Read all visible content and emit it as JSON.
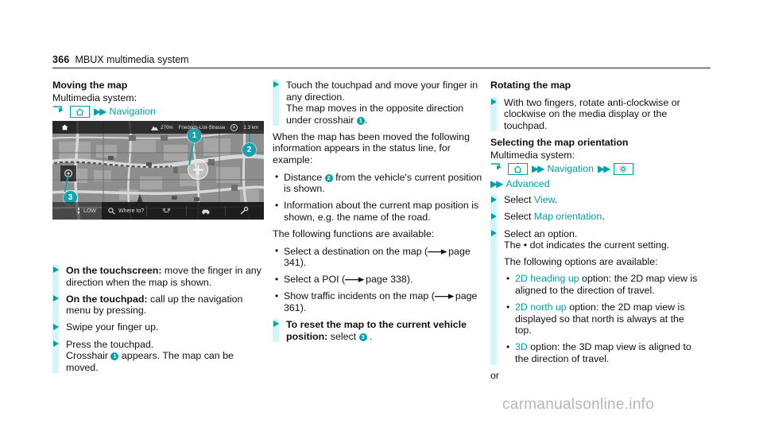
{
  "header": {
    "page_number": "366",
    "title": "MBUX multimedia system"
  },
  "watermark": "carmanualsonline.info",
  "colors": {
    "teal": "#00a0a8",
    "band": "#d2f5f7",
    "badge": "#17a2ad"
  },
  "col1": {
    "heading": "Moving the map",
    "intro": "Multimedia system:",
    "nav_path": {
      "return_icon": "return-arrow-icon",
      "home_icon": "home-icon",
      "chevrons": "▶▶",
      "destination": "Navigation"
    },
    "screenshot": {
      "name": "map-screenshot",
      "home_icon": "home-icon",
      "altitude": "270m",
      "street": "Friedrich-List-Strasse",
      "compass_icon": "compass-icon",
      "distance": "1.3 km",
      "low_label": "LOW",
      "search_icon": "search-icon",
      "search_label": "Where to?",
      "route_icon": "route-icon",
      "traffic_icon": "traffic-icon",
      "settings_icon": "map-settings-icon",
      "locate_icon": "locate-icon",
      "crosshair_icon": "crosshair-icon",
      "callouts": [
        "1",
        "2",
        "3"
      ]
    },
    "steps": [
      {
        "bold": "On the touchscreen:",
        "text": " move the finger in any direction when the map is shown."
      },
      {
        "bold": "On the touchpad:",
        "text": " call up the navigation menu by pressing."
      },
      {
        "bold": "",
        "text": "Swipe your finger up."
      },
      {
        "bold": "",
        "text": "Press the touchpad.",
        "line2_pre": "Crosshair ",
        "badge": "1",
        "line2_post": " appears. The map can be moved."
      }
    ]
  },
  "col2": {
    "step1": {
      "line1": "Touch the touchpad and move your finger in any direction.",
      "line2_pre": "The map moves in the opposite direction under crosshair ",
      "badge": "1",
      "line2_post": "."
    },
    "para1": "When the map has been moved the following information appears in the status line, for example:",
    "bullets1": [
      {
        "pre": "Distance ",
        "badge": "2",
        "post": " from the vehicle's current position is shown."
      },
      {
        "pre": "Information about the current map position is shown, e.g. the name of the road.",
        "badge": "",
        "post": ""
      }
    ],
    "para2": "The following functions are available:",
    "bullets2": [
      {
        "text": "Select a destination on the map (",
        "page": "page 341",
        "tail": ")."
      },
      {
        "text": "Select a POI (",
        "page": "page 338",
        "tail": ")."
      },
      {
        "text": "Show traffic incidents on the map (",
        "page": "page 361",
        "tail": ")."
      }
    ],
    "final_step": {
      "bold": "To reset the map to the current vehicle position:",
      "mid": " select ",
      "badge": "3",
      "tail": " ."
    }
  },
  "col3": {
    "heading1": "Rotating the map",
    "step1": "With two fingers, rotate anti-clockwise or clockwise on the media display or the touchpad.",
    "heading2": "Selecting the map orientation",
    "intro": "Multimedia system:",
    "nav_path": {
      "return_icon": "return-arrow-icon",
      "home_icon": "home-icon",
      "chevrons": "▶▶",
      "destination": "Navigation",
      "gear_icon": "gear-icon",
      "advanced": "Advanced"
    },
    "steps": [
      {
        "pre": "Select ",
        "link": "View",
        "post": "."
      },
      {
        "pre": "Select ",
        "link": "Map orientation",
        "post": "."
      },
      {
        "pre": "Select an option.",
        "link": "",
        "post": "",
        "line2": "The • dot indicates the current setting."
      }
    ],
    "para": "The following options are available:",
    "options": [
      {
        "link": "2D heading up",
        "text": " option: the 2D map view is aligned to the direction of travel."
      },
      {
        "link": "2D north up",
        "text": " option: the 2D map view is displayed so that north is always at the top."
      },
      {
        "link": "3D",
        "text": " option: the 3D map view is aligned to the direction of travel."
      }
    ],
    "or": "or"
  }
}
